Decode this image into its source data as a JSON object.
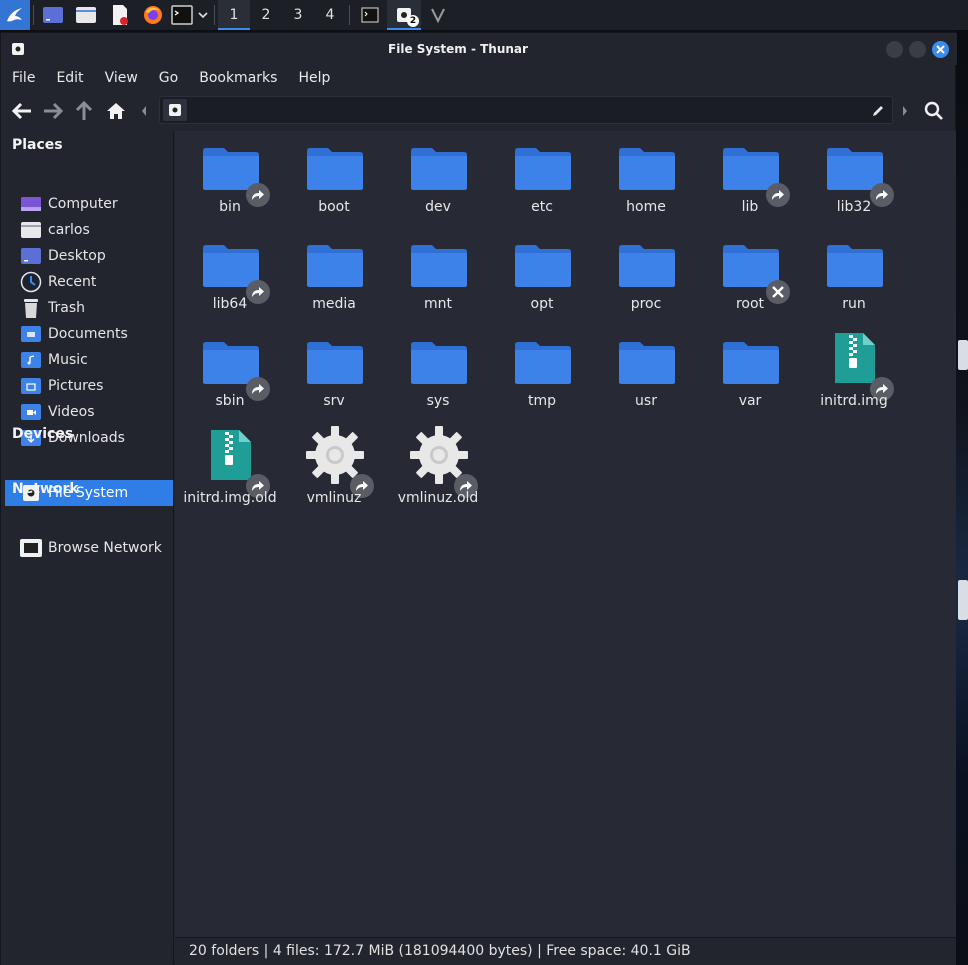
{
  "panel": {
    "workspaces": [
      "1",
      "2",
      "3",
      "4"
    ],
    "active_workspace": "1",
    "task_badge": "2"
  },
  "window": {
    "title": "File System - Thunar"
  },
  "menu": [
    "File",
    "Edit",
    "View",
    "Go",
    "Bookmarks",
    "Help"
  ],
  "location": {
    "path_value": ""
  },
  "sidebar": {
    "places_heading": "Places",
    "places": [
      {
        "label": "Computer",
        "icon": "computer-icon"
      },
      {
        "label": "carlos",
        "icon": "home-folder-icon"
      },
      {
        "label": "Desktop",
        "icon": "desktop-folder-icon"
      },
      {
        "label": "Recent",
        "icon": "recent-clock-icon"
      },
      {
        "label": "Trash",
        "icon": "trash-icon"
      },
      {
        "label": "Documents",
        "icon": "documents-folder-icon"
      },
      {
        "label": "Music",
        "icon": "music-folder-icon"
      },
      {
        "label": "Pictures",
        "icon": "pictures-folder-icon"
      },
      {
        "label": "Videos",
        "icon": "videos-folder-icon"
      },
      {
        "label": "Downloads",
        "icon": "downloads-folder-icon"
      }
    ],
    "devices_heading": "Devices",
    "devices": [
      {
        "label": "File System",
        "icon": "drive-icon",
        "selected": true
      }
    ],
    "network_heading": "Network",
    "network": [
      {
        "label": "Browse Network",
        "icon": "network-icon"
      }
    ]
  },
  "files": [
    {
      "name": "bin",
      "type": "folder",
      "emblem": "symlink"
    },
    {
      "name": "boot",
      "type": "folder",
      "emblem": ""
    },
    {
      "name": "dev",
      "type": "folder",
      "emblem": ""
    },
    {
      "name": "etc",
      "type": "folder",
      "emblem": ""
    },
    {
      "name": "home",
      "type": "folder",
      "emblem": ""
    },
    {
      "name": "lib",
      "type": "folder",
      "emblem": "symlink"
    },
    {
      "name": "lib32",
      "type": "folder",
      "emblem": "symlink"
    },
    {
      "name": "lib64",
      "type": "folder",
      "emblem": "symlink"
    },
    {
      "name": "media",
      "type": "folder",
      "emblem": ""
    },
    {
      "name": "mnt",
      "type": "folder",
      "emblem": ""
    },
    {
      "name": "opt",
      "type": "folder",
      "emblem": ""
    },
    {
      "name": "proc",
      "type": "folder",
      "emblem": ""
    },
    {
      "name": "root",
      "type": "folder",
      "emblem": "unreadable"
    },
    {
      "name": "run",
      "type": "folder",
      "emblem": ""
    },
    {
      "name": "sbin",
      "type": "folder",
      "emblem": "symlink"
    },
    {
      "name": "srv",
      "type": "folder",
      "emblem": ""
    },
    {
      "name": "sys",
      "type": "folder",
      "emblem": ""
    },
    {
      "name": "tmp",
      "type": "folder",
      "emblem": ""
    },
    {
      "name": "usr",
      "type": "folder",
      "emblem": ""
    },
    {
      "name": "var",
      "type": "folder",
      "emblem": ""
    },
    {
      "name": "initrd.img",
      "type": "archive",
      "emblem": "symlink"
    },
    {
      "name": "initrd.img.old",
      "type": "archive",
      "emblem": "symlink"
    },
    {
      "name": "vmlinuz",
      "type": "executable",
      "emblem": "symlink"
    },
    {
      "name": "vmlinuz.old",
      "type": "executable",
      "emblem": "symlink"
    }
  ],
  "status": {
    "text": "20 folders  |  4 files: 172.7 MiB (181094400 bytes)  |  Free space: 40.1 GiB"
  },
  "colors": {
    "accent": "#2f7ee8",
    "folder": "#3d82e8",
    "archive": "#1f9e98"
  }
}
